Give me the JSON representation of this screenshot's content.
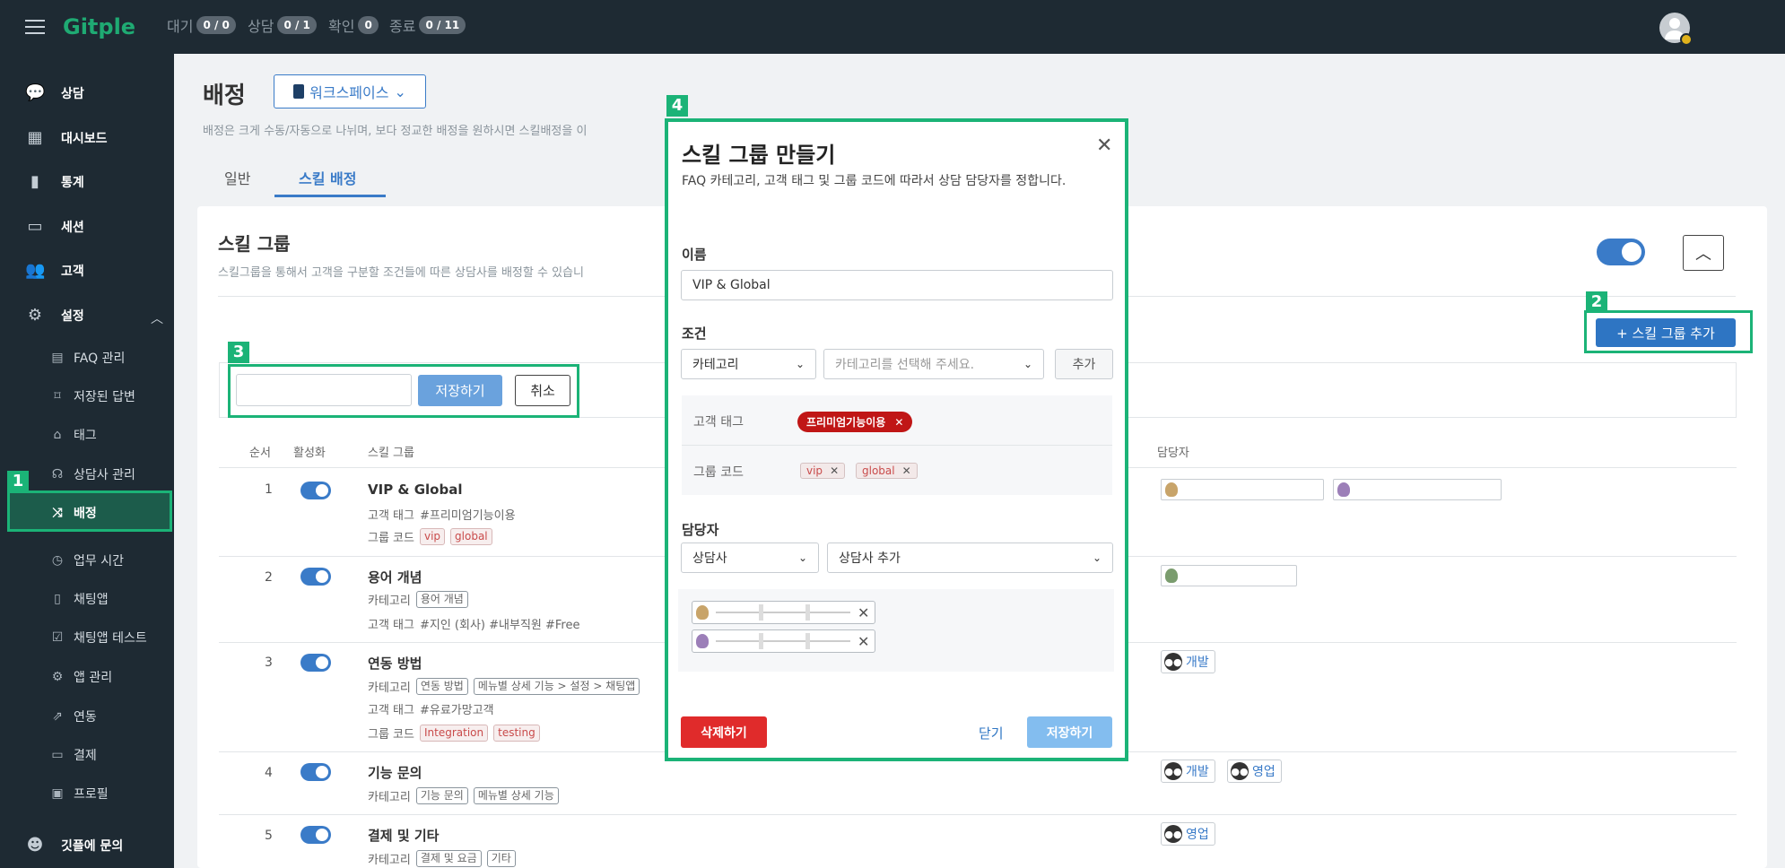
{
  "app": {
    "logo": "Gitple"
  },
  "queue": [
    {
      "label": "대기",
      "value": "0 / 0"
    },
    {
      "label": "상담",
      "value": "0 / 1"
    },
    {
      "label": "확인",
      "value": "0"
    },
    {
      "label": "종료",
      "value": "0 / 11"
    }
  ],
  "sidebar": {
    "items": [
      {
        "label": "상담",
        "icon": "chat-bubble-icon"
      },
      {
        "label": "대시보드",
        "icon": "dashboard-icon"
      },
      {
        "label": "통계",
        "icon": "bar-chart-icon"
      },
      {
        "label": "세션",
        "icon": "folder-icon"
      },
      {
        "label": "고객",
        "icon": "people-icon"
      },
      {
        "label": "설정",
        "icon": "gear-icon"
      }
    ],
    "sub_items": [
      {
        "label": "FAQ 관리",
        "icon": "document-icon"
      },
      {
        "label": "저장된 답변",
        "icon": "bookmark-icon"
      },
      {
        "label": "태그",
        "icon": "tag-icon"
      },
      {
        "label": "상담사 관리",
        "icon": "headset-icon"
      },
      {
        "label": "배정",
        "icon": "shuffle-icon"
      },
      {
        "label": "업무 시간",
        "icon": "clock-icon"
      },
      {
        "label": "채팅앱",
        "icon": "phone-icon"
      },
      {
        "label": "채팅앱 테스트",
        "icon": "check-doc-icon"
      },
      {
        "label": "앱 관리",
        "icon": "settings-icon"
      },
      {
        "label": "연동",
        "icon": "link-icon"
      },
      {
        "label": "결제",
        "icon": "card-icon"
      },
      {
        "label": "프로필",
        "icon": "profile-icon"
      }
    ],
    "help": "깃플에 문의",
    "active_sub": "배정"
  },
  "annotations": [
    "1",
    "2",
    "3",
    "4"
  ],
  "page": {
    "title": "배정",
    "workspace": "워크스페이스",
    "description": "배정은 크게 수동/자동으로 나뉘며, 보다 정교한 배정을 원하시면 스킬배정을 이",
    "tabs": [
      "일반",
      "스킬 배정"
    ],
    "active_tab": "스킬 배정"
  },
  "skill_card": {
    "title": "스킬 그룹",
    "description": "스킬그룹을 통해서 고객을 구분할 조건들에 따른 상담사를 배정할 수 있습니",
    "add_button": "+ 스킬 그룹 추가",
    "edit": {
      "save": "저장하기",
      "cancel": "취소"
    },
    "headers": [
      "순서",
      "활성화",
      "스킬 그룹",
      "담당자"
    ],
    "rows": [
      {
        "num": "1",
        "name": "VIP & Global",
        "tag_line_label": "고객 태그",
        "tag_line_value": "#프리미엄기능이용",
        "code_label": "그룹 코드",
        "codes": [
          "vip",
          "global"
        ]
      },
      {
        "num": "2",
        "name": "용어 개념",
        "cat_label": "카테고리",
        "cats": [
          "용어 개념"
        ],
        "tag_line_label": "고객 태그",
        "tag_line_value": "#지인 (회사) #내부직원 #Free"
      },
      {
        "num": "3",
        "name": "연동 방법",
        "cat_label": "카테고리",
        "cats": [
          "연동 방법",
          "메뉴별 상세 기능 > 설정 > 채팅앱"
        ],
        "tag_line_label": "고객 태그",
        "tag_line_value": "#유료가망고객",
        "code_label": "그룹 코드",
        "codes": [
          "Integration",
          "testing"
        ],
        "teams": [
          "개발"
        ]
      },
      {
        "num": "4",
        "name": "기능 문의",
        "cat_label": "카테고리",
        "cats": [
          "기능 문의",
          "메뉴별 상세 기능"
        ],
        "teams": [
          "개발",
          "영업"
        ]
      },
      {
        "num": "5",
        "name": "결제 및 기타",
        "cat_label": "카테고리",
        "cats": [
          "결제 및 요금",
          "기타"
        ],
        "teams": [
          "영업"
        ]
      }
    ]
  },
  "modal": {
    "title": "스킬 그룹 만들기",
    "description": "FAQ 카테고리, 고객 태그 및 그룹 코드에 따라서 상담 담당자를 정합니다.",
    "name_label": "이름",
    "name_value": "VIP & Global",
    "cond_label": "조건",
    "cond_type": "카테고리",
    "cond_placeholder": "카테고리를 선택해 주세요.",
    "cond_add": "추가",
    "customer_tag_label": "고객 태그",
    "customer_tags": [
      "프리미엄기능이용"
    ],
    "group_code_label": "그룹 코드",
    "group_codes": [
      "vip",
      "global"
    ],
    "assignee_label": "담당자",
    "assignee_type": "상담사",
    "assignee_add": "상담사 추가",
    "delete": "삭제하기",
    "close": "닫기",
    "save": "저장하기"
  }
}
